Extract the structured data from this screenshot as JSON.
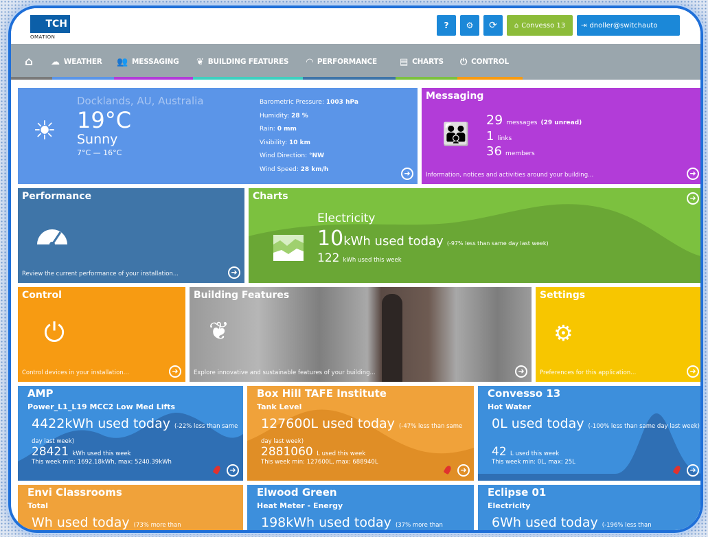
{
  "header": {
    "logo_text": "TCH",
    "logo_sub": "OMATION",
    "help_icon": "?",
    "refresh_icon": "⟳",
    "site_button": "Convesso 13",
    "user_button": "dnoller@switchauto"
  },
  "nav": {
    "items": [
      {
        "label": "WEATHER"
      },
      {
        "label": "MESSAGING"
      },
      {
        "label": "BUILDING FEATURES"
      },
      {
        "label": "PERFORMANCE"
      },
      {
        "label": "CHARTS"
      },
      {
        "label": "CONTROL"
      }
    ]
  },
  "weather": {
    "location": "Docklands, AU, Australia",
    "temp": "19°C",
    "condition": "Sunny",
    "range": "7°C — 16°C",
    "details": [
      {
        "label": "Barometric Pressure:",
        "value": "1003 hPa"
      },
      {
        "label": "Humidity:",
        "value": "28 %"
      },
      {
        "label": "Rain:",
        "value": "0 mm"
      },
      {
        "label": "Visibility:",
        "value": "10 km"
      },
      {
        "label": "Wind Direction:",
        "value": "°NW"
      },
      {
        "label": "Wind Speed:",
        "value": "28 km/h"
      }
    ]
  },
  "messaging": {
    "title": "Messaging",
    "messages_count": "29",
    "messages_label": "messages",
    "unread": "(29 unread)",
    "links_count": "1",
    "links_label": "links",
    "members_count": "36",
    "members_label": "members",
    "desc": "Information, notices and activities around your building..."
  },
  "performance": {
    "title": "Performance",
    "desc": "Review the current performance of your installation..."
  },
  "charts": {
    "title": "Charts",
    "subject": "Electricity",
    "value": "10",
    "unit": "kWh used today",
    "compare": "(-97% less than same day last week)",
    "week_value": "122",
    "week_label": "kWh used this week"
  },
  "control": {
    "title": "Control",
    "desc": "Control devices in your installation..."
  },
  "building_features": {
    "title": "Building Features",
    "desc": "Explore innovative and sustainable features of your building..."
  },
  "settings": {
    "title": "Settings",
    "desc": "Preferences for this application..."
  },
  "meters": [
    {
      "title": "AMP",
      "subtitle": "Power_L1_L19 MCC2 Low Med Lifts",
      "today_value": "4422",
      "today_unit": "kWh used today",
      "compare": "(-22% less than same day last week)",
      "week_value": "28421",
      "week_label": "kWh used this week",
      "minmax": "This week min: 1692.18kWh, max: 5240.39kWh"
    },
    {
      "title": "Box Hill TAFE Institute",
      "subtitle": "Tank Level",
      "today_value": "127600",
      "today_unit": "L used today",
      "compare": "(-47% less than same day last week)",
      "week_value": "2881060",
      "week_label": "L used this week",
      "minmax": "This week min: 127600L, max: 688940L"
    },
    {
      "title": "Convesso 13",
      "subtitle": "Hot Water",
      "today_value": "0",
      "today_unit": "L used today",
      "compare": "(-100% less than same day last week)",
      "week_value": "42",
      "week_label": "L used this week",
      "minmax": "This week min: 0L, max: 25L"
    },
    {
      "title": "Envi Classrooms",
      "subtitle": "Total",
      "today_value": "",
      "today_unit": "Wh used today",
      "compare": "(73% more than"
    },
    {
      "title": "Elwood Green",
      "subtitle": "Heat Meter - Energy",
      "today_value": "198",
      "today_unit": "kWh used today",
      "compare": "(37% more than"
    },
    {
      "title": "Eclipse 01",
      "subtitle": "Electricity",
      "today_value": "6",
      "today_unit": "Wh used today",
      "compare": "(-196% less than"
    }
  ],
  "colors": {
    "weather": "#5b95e8",
    "messaging": "#b23cd8",
    "performance": "#3f75a8",
    "charts": "#7cc13f",
    "control": "#f79b12",
    "settings": "#f7c600",
    "meter_blue": "#3d8fdc",
    "meter_orange": "#f0a23a"
  }
}
